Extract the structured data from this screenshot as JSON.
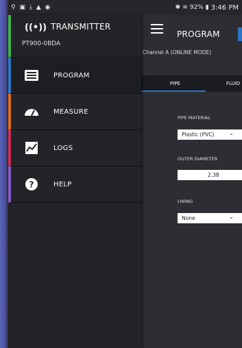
{
  "status_bar": {
    "left_icons": [
      "usb-icon",
      "image-icon",
      "download-icon",
      "warning-icon",
      "message-icon"
    ],
    "right_icons": [
      "bluetooth-icon",
      "wifi-icon"
    ],
    "battery": "92%",
    "time": "3:46 PM"
  },
  "drawer": {
    "app_title": "TRANSMITTER",
    "device_id": "PT900-0BDA",
    "items": [
      {
        "label": "PROGRAM",
        "icon": "program-icon",
        "color": "#2d74c4"
      },
      {
        "label": "MEASURE",
        "icon": "gauge-icon",
        "color": "#e36a1c"
      },
      {
        "label": "LOGS",
        "icon": "chart-icon",
        "color": "#cf2e55"
      },
      {
        "label": "HELP",
        "icon": "help-icon",
        "color": "#8a5ac9"
      }
    ],
    "header_color": "#3fb14a"
  },
  "main": {
    "title": "PROGRAM",
    "channel": "Channel A (ONLINE MODE)",
    "tabs": [
      "PIPE",
      "FLUID"
    ],
    "active_tab": "PIPE",
    "fields": {
      "pipe_material": {
        "label": "PIPE MATERIAL",
        "value": "Plastic (PVC)"
      },
      "outer_diameter": {
        "label": "OUTER DIAMETER",
        "value": "2.38"
      },
      "lining": {
        "label": "LINING",
        "value": "None"
      }
    }
  }
}
